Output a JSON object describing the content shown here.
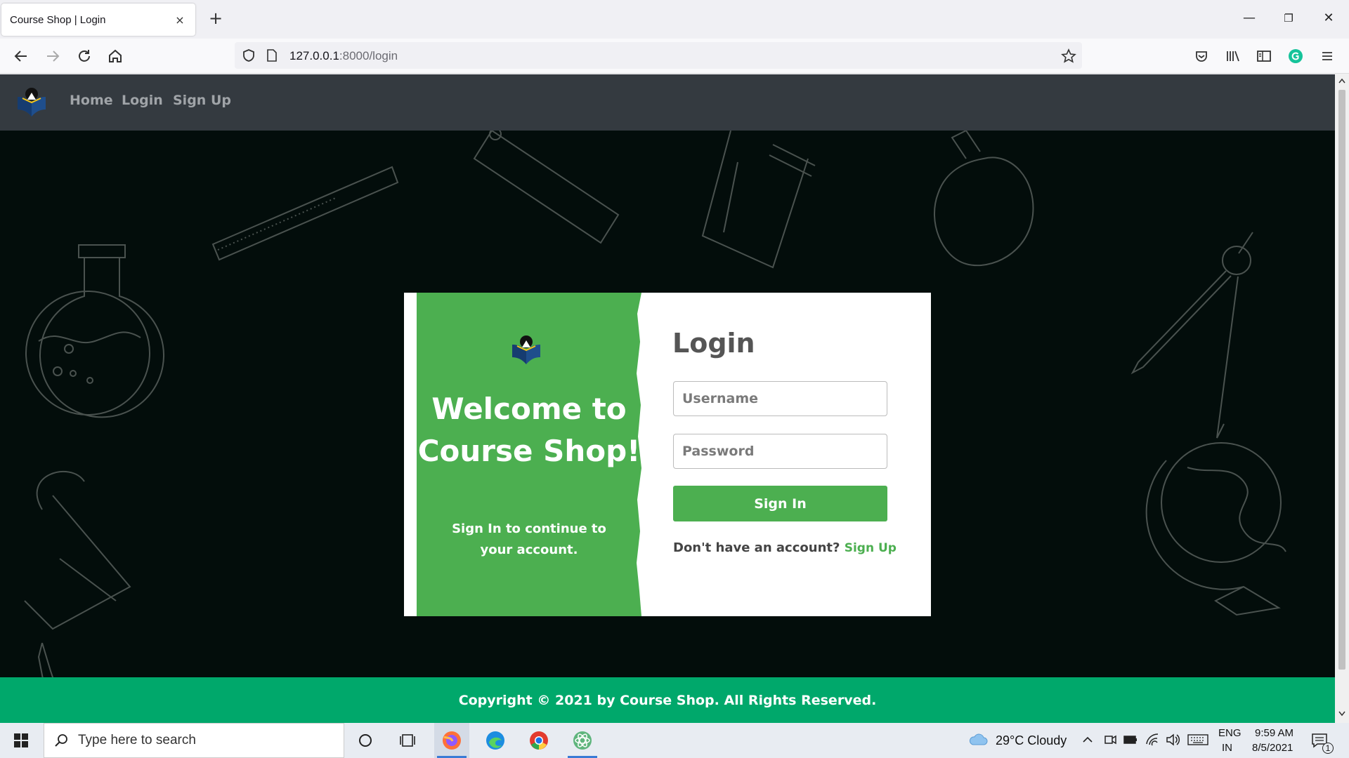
{
  "browser": {
    "tab_title": "Course Shop | Login",
    "tab_close": "×",
    "new_tab": "+",
    "url_host": "127.0.0.1",
    "url_rest": ":8000/login",
    "window_controls": {
      "minimize": "—",
      "restore": "❐",
      "close": "✕"
    }
  },
  "site": {
    "nav_links": [
      "Home",
      "Login",
      "Sign Up"
    ],
    "accent_color": "#4caf50",
    "footer_color": "#00a86b"
  },
  "card": {
    "welcome": "Welcome to Course Shop!",
    "welcome_sub": "Sign In to continue to your account.",
    "title": "Login",
    "username_placeholder": "Username",
    "password_placeholder": "Password",
    "signin_label": "Sign In",
    "no_account_text": "Don't have an account?",
    "signup_link": "Sign Up"
  },
  "footer": {
    "text": "Copyright © 2021 by Course Shop. All Rights Reserved."
  },
  "taskbar": {
    "search_placeholder": "Type here to search",
    "weather": "29°C  Cloudy",
    "lang_top": "ENG",
    "lang_bottom": "IN",
    "time": "9:59 AM",
    "date": "8/5/2021",
    "notification_count": "1"
  }
}
